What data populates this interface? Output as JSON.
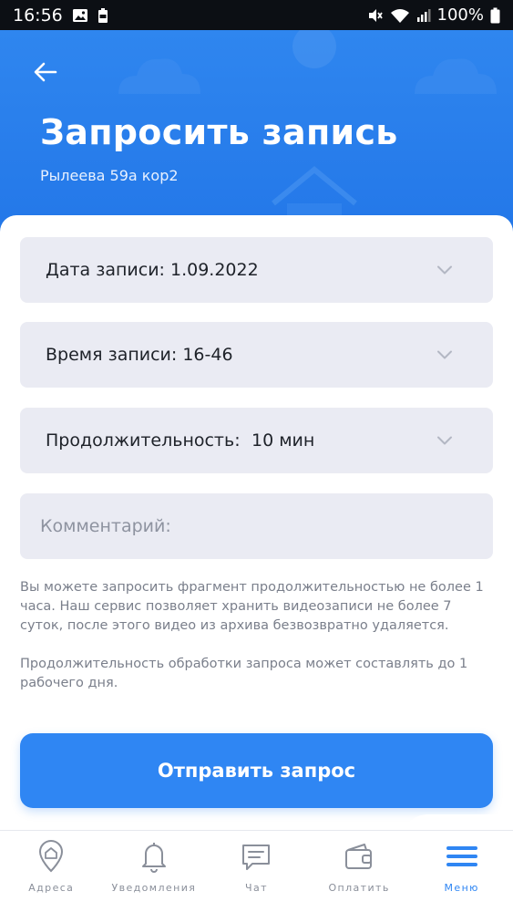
{
  "status_bar": {
    "time": "16:56",
    "battery": "100%",
    "icons": [
      "image-icon",
      "battery-saver-icon",
      "mute-icon",
      "wifi-icon",
      "signal-icon",
      "battery-icon"
    ]
  },
  "header": {
    "title": "Запросить запись",
    "subtitle": "Рылеева 59а кор2",
    "back_icon": "arrow-left-icon"
  },
  "form": {
    "date": {
      "label": "Дата записи: 1.09.2022"
    },
    "time": {
      "label": "Время записи: 16-46"
    },
    "duration": {
      "label": "Продолжительность:",
      "value": "10 мин"
    },
    "comment": {
      "placeholder": "Комментарий:",
      "value": ""
    }
  },
  "info": {
    "paragraph1": "Вы можете запросить фрагмент продолжительностью не более 1 часа. Наш сервис позволяет хранить видеозаписи не более 7 суток, после этого видео из архива безвозвратно удаляется.",
    "paragraph2": "Продолжительность обработки запроса может составлять до 1 рабочего дня."
  },
  "submit_label": "Отправить запрос",
  "nav": {
    "items": [
      {
        "label": "Адреса",
        "icon": "location-home-icon"
      },
      {
        "label": "Уведомления",
        "icon": "bell-icon"
      },
      {
        "label": "Чат",
        "icon": "chat-icon"
      },
      {
        "label": "Оплатить",
        "icon": "wallet-icon"
      },
      {
        "label": "Меню",
        "icon": "hamburger-menu-icon"
      }
    ],
    "active": "Меню"
  },
  "colors": {
    "accent": "#2f86f3",
    "header": "#2377e8",
    "field_bg": "#eaebf3",
    "muted_text": "#7a7f8b"
  }
}
